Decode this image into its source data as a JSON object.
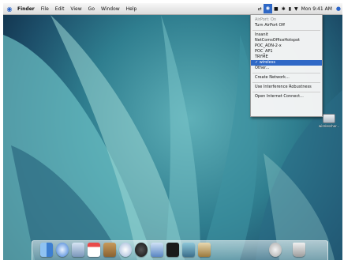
{
  "menubar": {
    "app": "Finder",
    "items": [
      "File",
      "Edit",
      "View",
      "Go",
      "Window",
      "Help"
    ],
    "clock": "Mon 9:41 AM"
  },
  "airport_menu": {
    "status": "AirPort: On",
    "toggle": "Turn AirPort Off",
    "networks": [
      "Insanit",
      "NetComsOfficeHotspot",
      "POC_ADN-2-x",
      "POC_AP1",
      "TRYME",
      "wireless"
    ],
    "selected_network": "wireless",
    "other": "Other...",
    "create_network": "Create Network...",
    "interference": "Use Interference Robustness",
    "open_connect": "Open Internet Connect..."
  },
  "desktop": {
    "icon_label": "wirelesshar..."
  },
  "dock": {
    "icons": [
      "finder-icon",
      "safari-icon",
      "mail-icon",
      "ical-icon",
      "addressbook-icon",
      "itunes-icon",
      "dashboard-icon",
      "bluetooth-icon",
      "terminal-icon",
      "preview-icon",
      "photos-icon",
      "globe-icon",
      "trash-icon"
    ]
  },
  "colors": {
    "selection": "#2f68c6",
    "wallpaper": "#2f7e8f"
  }
}
